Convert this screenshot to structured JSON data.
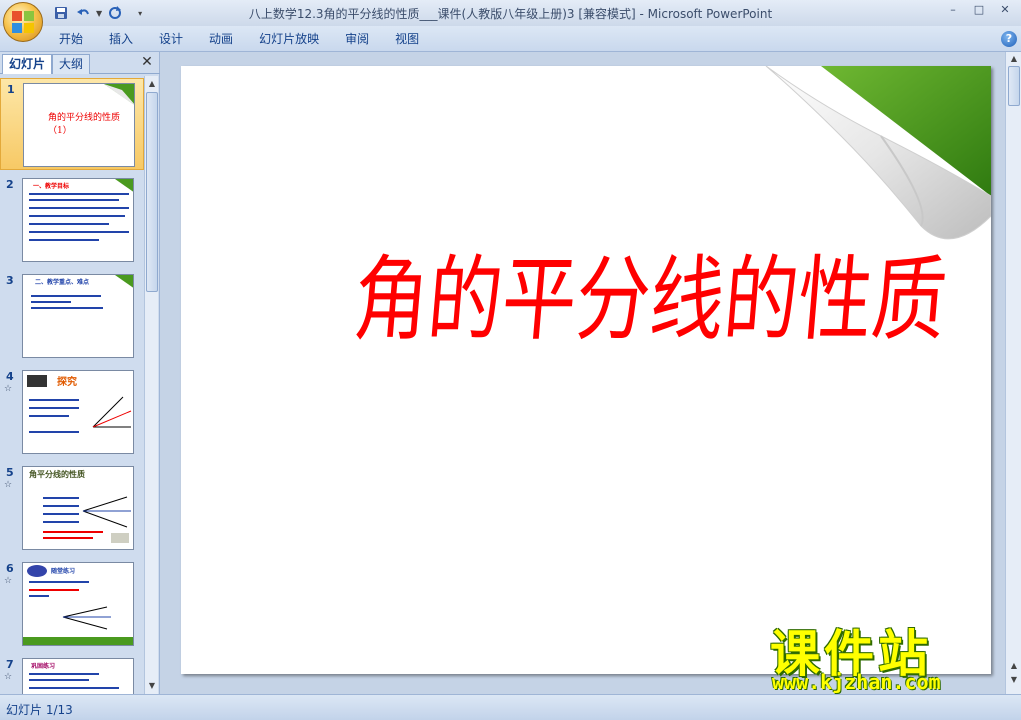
{
  "window": {
    "title": "八上数学12.3角的平分线的性质___课件(人教版八年级上册)3 [兼容模式] - Microsoft PowerPoint"
  },
  "window_controls": {
    "minimize": "–",
    "restore": "□",
    "close": "✕"
  },
  "ribbon": {
    "tabs": [
      "开始",
      "插入",
      "设计",
      "动画",
      "幻灯片放映",
      "审阅",
      "视图"
    ]
  },
  "left_pane": {
    "tabs": [
      "幻灯片",
      "大纲"
    ],
    "close": "✕",
    "slides": [
      {
        "num": "1",
        "anim": "",
        "title": "角的平分线的性质（1）"
      },
      {
        "num": "2",
        "anim": "",
        "heading": "一、教学目标"
      },
      {
        "num": "3",
        "anim": "",
        "heading": "二、教学重点、难点"
      },
      {
        "num": "4",
        "anim": "☆",
        "heading": "探究"
      },
      {
        "num": "5",
        "anim": "☆",
        "heading": "角平分线的性质"
      },
      {
        "num": "6",
        "anim": "☆",
        "heading": "随堂练习"
      },
      {
        "num": "7",
        "anim": "☆",
        "heading": "巩固练习"
      }
    ]
  },
  "slide": {
    "title": "角的平分线的性质（1）",
    "title_color": "#ff0000"
  },
  "watermark": {
    "main": "课件站",
    "url": "www.kjzhan.com"
  },
  "status": {
    "text": "幻灯片 1/13"
  },
  "colors": {
    "ribbon_text": "#15428b",
    "selection": "#f7c965",
    "page_curl_green": "#4a9a1f"
  }
}
